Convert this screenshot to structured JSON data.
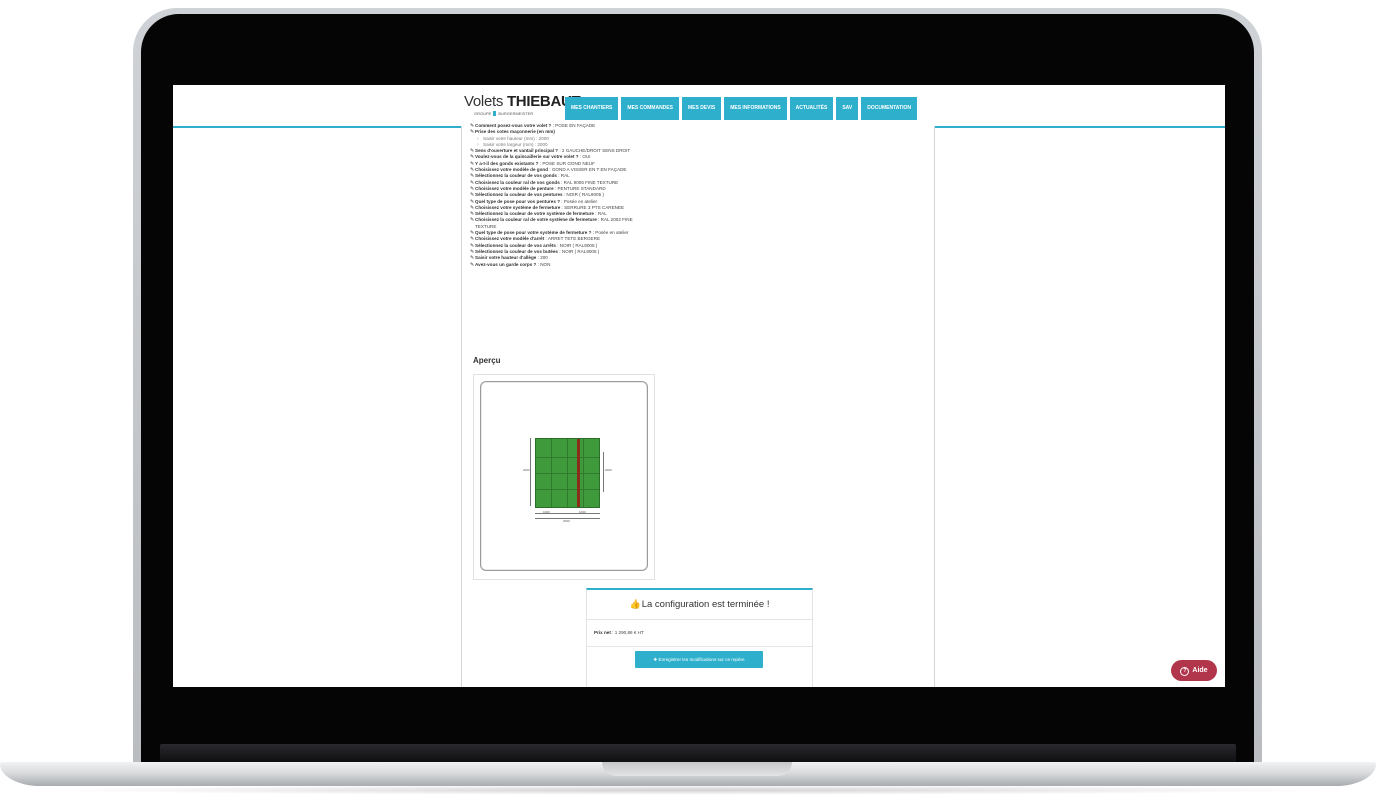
{
  "brand": {
    "name_light": "Volets",
    "name_bold": "THIEBAUT",
    "tagline_left": "GROUPE",
    "tagline_right": "BURGERMEISTER"
  },
  "nav": [
    {
      "label": "MES CHANTIERS"
    },
    {
      "label": "MES COMMANDES"
    },
    {
      "label": "MES DEVIS"
    },
    {
      "label": "MES INFORMATIONS"
    },
    {
      "label": "ACTUALITÉS"
    },
    {
      "label": "SAV"
    },
    {
      "label": "DOCUMENTATION"
    }
  ],
  "config_rows": [
    {
      "q": "Comment posez-vous votre volet ?",
      "a": "POSE EN FAÇADE",
      "kind": "top"
    },
    {
      "q": "Prise des cotes maçonnerie (en mm)",
      "a": "",
      "kind": "main"
    },
    {
      "q": "",
      "a": "Saisir votre hauteur (mm) : 2000",
      "kind": "sub"
    },
    {
      "q": "",
      "a": "Saisir votre largeur (mm) : 2000",
      "kind": "sub"
    },
    {
      "q": "Sens d'ouverture et vantail principal ?",
      "a": "2 GAUCHE/DROIT SENS DROIT",
      "kind": "main"
    },
    {
      "q": "Voulez-vous de la quincaillerie sur votre volet ?",
      "a": "OUI",
      "kind": "main"
    },
    {
      "q": "Y a-t-il des gonds existants ?",
      "a": "POSE SUR GOND NEUF",
      "kind": "main"
    },
    {
      "q": "Choisissez votre modèle de gond",
      "a": "GOND A VISSER EN T EN FAÇADE",
      "kind": "main"
    },
    {
      "q": "Sélectionnez la couleur de vos gonds",
      "a": "RAL",
      "kind": "main"
    },
    {
      "q": "Choisissez la couleur ral de vos gonds",
      "a": "RAL 9006 FINE TEXTURE",
      "kind": "main"
    },
    {
      "q": "Choisissez votre modèle de penture",
      "a": "PENTURE STANDARD",
      "kind": "main"
    },
    {
      "q": "Sélectionnez la couleur de vos pentures",
      "a": "NOIR ( RAL9005 )",
      "kind": "main"
    },
    {
      "q": "Quel type de pose pour vos pentures ?",
      "a": "Posée en atelier",
      "kind": "main"
    },
    {
      "q": "Choisissez votre système de fermeture",
      "a": "SERRURE 3 PTS CARENEE",
      "kind": "main"
    },
    {
      "q": "Sélectionnez la couleur de votre système de fermeture",
      "a": "RAL",
      "kind": "main"
    },
    {
      "q": "Choisissez la couleur ral de votre système de fermeture",
      "a": "RAL 2002 FINE TEXTURE",
      "kind": "main"
    },
    {
      "q": "Quel type de pose pour votre système de fermeture ?",
      "a": "Posée en atelier",
      "kind": "main"
    },
    {
      "q": "Choisissez votre modèle d'arrêt",
      "a": "ARRET TETE BERGERE",
      "kind": "main"
    },
    {
      "q": "Sélectionnez la couleur de vos arrêts",
      "a": "NOIR ( RAL9005 )",
      "kind": "main"
    },
    {
      "q": "Sélectionnez la couleur de vos butées",
      "a": "NOIR ( RAL9005 )",
      "kind": "main"
    },
    {
      "q": "Saisir votre hauteur d'allège",
      "a": "200",
      "kind": "main"
    },
    {
      "q": "Avez-vous un garde corps ?",
      "a": "NON",
      "kind": "main"
    }
  ],
  "preview": {
    "title": "Aperçu",
    "dim_bottom_left": "1000",
    "dim_bottom_right": "1000",
    "dim_total": "2000",
    "dim_left": "2000",
    "dim_right": "2000"
  },
  "summary": {
    "title": "La configuration est terminée !",
    "price_label": "Prix net",
    "price_value": "1 290,86 € HT",
    "save_button": "Enregistrer les modifications sur ce repère"
  },
  "help_button": {
    "label": "Aide"
  },
  "colors": {
    "accent": "#2eb0cd",
    "help": "#b2364b",
    "shutter_green": "#3f9a3c",
    "lock_bar": "#8a2e1c"
  }
}
